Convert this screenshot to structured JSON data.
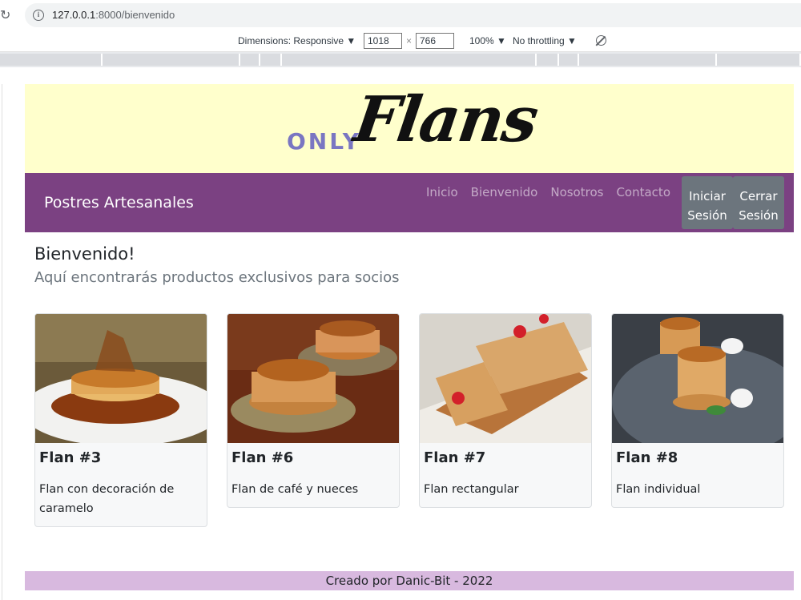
{
  "browser": {
    "url_host": "127.0.0.1",
    "url_rest": ":8000/bienvenido",
    "reload_icon": "reload-icon",
    "info_icon": "info-icon"
  },
  "devtools": {
    "dimensions_label": "Dimensions: Responsive ▼",
    "width_value": "1018",
    "height_value": "766",
    "times": "×",
    "zoom": "100% ▼",
    "throttling": "No throttling ▼",
    "rotate_icon": "rotate-icon"
  },
  "header": {
    "logo_only": "ONLY",
    "logo_flans": "Flans"
  },
  "navbar": {
    "brand": "Postres Artesanales",
    "links": [
      "Inicio",
      "Bienvenido",
      "Nosotros",
      "Contacto"
    ],
    "login_line1": "Iniciar",
    "login_line2": "Sesión",
    "logout_line1": "Cerrar",
    "logout_line2": "Sesión"
  },
  "main": {
    "title": "Bienvenido!",
    "subtitle": "Aquí encontrarás productos exclusivos para socios"
  },
  "cards": [
    {
      "title": "Flan #3",
      "text": "Flan con decoración de caramelo"
    },
    {
      "title": "Flan #6",
      "text": "Flan de café y nueces"
    },
    {
      "title": "Flan #7",
      "text": "Flan rectangular"
    },
    {
      "title": "Flan #8",
      "text": "Flan individual"
    }
  ],
  "footer": {
    "text": "Creado por Danic-Bit - 2022"
  },
  "colors": {
    "banner_bg": "#ffffcc",
    "navbar_bg": "#7b4182",
    "button_bg": "#6c757d",
    "footer_bg": "#d8b9df",
    "logo_accent": "#7a76c2"
  }
}
